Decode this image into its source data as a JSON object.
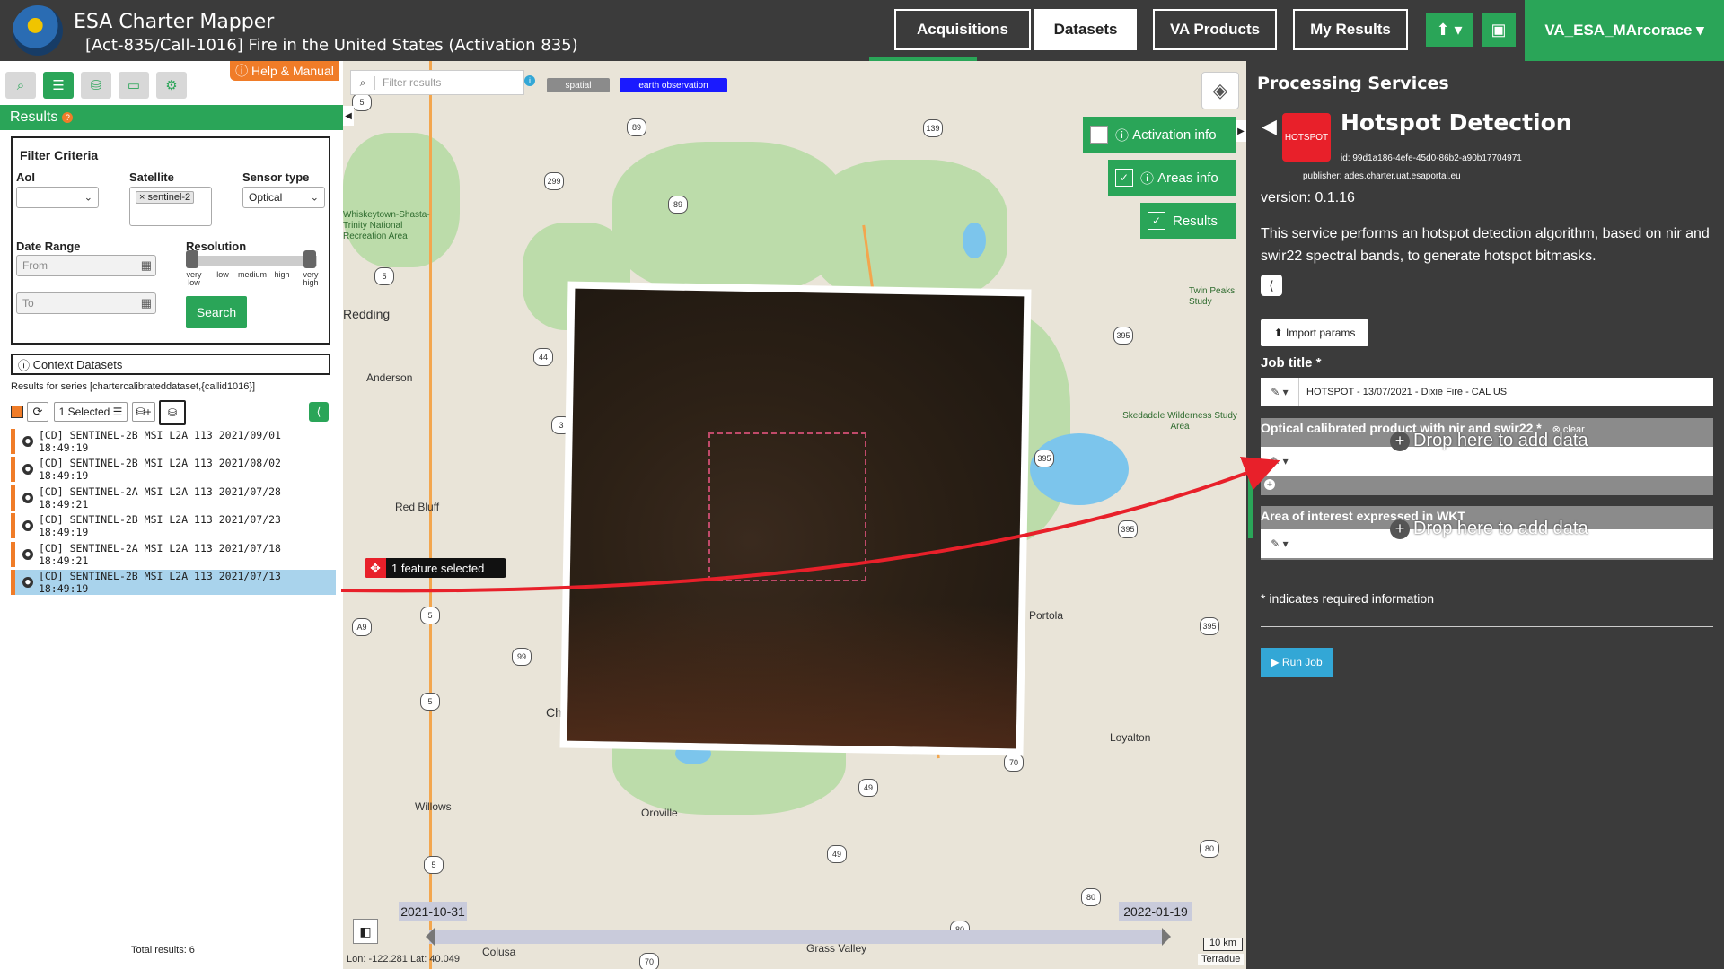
{
  "header": {
    "title": "ESA Charter Mapper",
    "subtitle": "[Act-835/Call-1016] Fire in the United States (Activation 835)",
    "nav": [
      "Acquisitions",
      "Datasets",
      "VA Products",
      "My Results"
    ],
    "active_nav": "Datasets",
    "user": "VA_ESA_MArcorace",
    "upload_icon": "upload-icon",
    "briefcase_icon": "briefcase-icon"
  },
  "left": {
    "help_label": "Help & Manual",
    "results_label": "Results",
    "filter": {
      "title": "Filter Criteria",
      "aoi_label": "AoI",
      "satellite_label": "Satellite",
      "satellite_tag": "sentinel-2",
      "sensor_label": "Sensor type",
      "sensor_value": "Optical",
      "date_label": "Date Range",
      "from_placeholder": "From",
      "to_placeholder": "To",
      "resolution_label": "Resolution",
      "resolution_ticks": [
        "very low",
        "low",
        "medium",
        "high",
        "very high"
      ],
      "search_label": "Search"
    },
    "context_label": "Context Datasets",
    "series_text": "Results for series [chartercalibrateddataset,{callid1016}]",
    "selected_label": "1 Selected",
    "datasets": [
      "[CD] SENTINEL-2B MSI L2A 113 2021/09/01 18:49:19",
      "[CD] SENTINEL-2B MSI L2A 113 2021/08/02 18:49:19",
      "[CD] SENTINEL-2A MSI L2A 113 2021/07/28 18:49:21",
      "[CD] SENTINEL-2B MSI L2A 113 2021/07/23 18:49:19",
      "[CD] SENTINEL-2A MSI L2A 113 2021/07/18 18:49:21",
      "[CD] SENTINEL-2B MSI L2A 113 2021/07/13 18:49:19"
    ],
    "selected_index": 5,
    "total": "Total results: 6"
  },
  "map": {
    "search_placeholder": "Filter results",
    "chip_spatial": "spatial",
    "chip_eo": "earth observation",
    "toggles": [
      "Activation info",
      "Areas info",
      "Results"
    ],
    "feature_badge": "1 feature selected",
    "places": [
      "Redding",
      "Anderson",
      "Red Bluff",
      "Willows",
      "Oroville",
      "Portola",
      "Loyalton",
      "Colusa",
      "Grass Valley",
      "Ch",
      "Whiskeytown-Shasta-Trinity National Recreation Area",
      "Skedaddle Wilderness Study Area",
      "Twin Peaks Study"
    ],
    "timeline_start": "2021-10-31",
    "timeline_end": "2022-01-19",
    "coords": "Lon: -122.281 Lat: 40.049",
    "scale": "10 km",
    "attribution": "Terradue",
    "highway_shields": [
      "5",
      "89",
      "139",
      "299",
      "89",
      "395",
      "44",
      "5",
      "395",
      "395",
      "A9",
      "5",
      "99",
      "5",
      "70",
      "49",
      "395",
      "5",
      "49",
      "80",
      "80",
      "80",
      "70",
      "3"
    ]
  },
  "processing": {
    "panel_title": "Processing Services",
    "service_name": "Hotspot Detection",
    "service_icon_text": "HOTSPOT",
    "service_id": "id: 99d1a186-4efe-45d0-86b2-a90b17704971",
    "publisher": "publisher: ades.charter.uat.esaportal.eu",
    "version": "version: 0.1.16",
    "description": "This service performs an hotspot detection algorithm, based on nir and swir22 spectral bands, to generate hotspot bitmasks.",
    "import_label": "Import params",
    "job_title_label": "Job title *",
    "job_title_value": "HOTSPOT - 13/07/2021 - Dixie Fire - CAL US",
    "optical_label": "Optical calibrated product with nir and swir22 *",
    "clear_label": "clear",
    "drop_text": "Drop here to add data",
    "aoi_label": "Area of interest expressed in WKT",
    "required_note": "* indicates required information",
    "run_label": "Run Job"
  }
}
